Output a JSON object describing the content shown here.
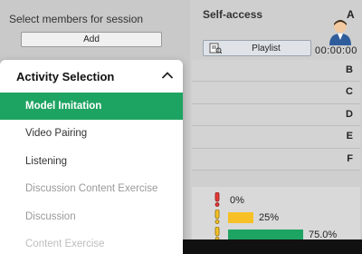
{
  "members": {
    "title": "Select members for session",
    "add_label": "Add"
  },
  "self_access": {
    "title": "Self-access",
    "group_letter": "A",
    "playlist_label": "Playlist",
    "timer": "00:00:00"
  },
  "rows": [
    "B",
    "C",
    "D",
    "E",
    "F"
  ],
  "progress": [
    {
      "label": "0%",
      "color": "#e53935",
      "fill": 0
    },
    {
      "label": "25%",
      "color": "#f6c026",
      "fill": 0.25
    },
    {
      "label": "75.0%",
      "color": "#1ea462",
      "fill": 0.75
    }
  ],
  "dropdown": {
    "title": "Activity Selection",
    "items": [
      "Model Imitation",
      "Video Pairing",
      "Listening",
      "Discussion Content Exercise",
      "Discussion",
      "Content Exercise"
    ],
    "selected_index": 0
  },
  "colors": {
    "accent": "#1ea462"
  }
}
